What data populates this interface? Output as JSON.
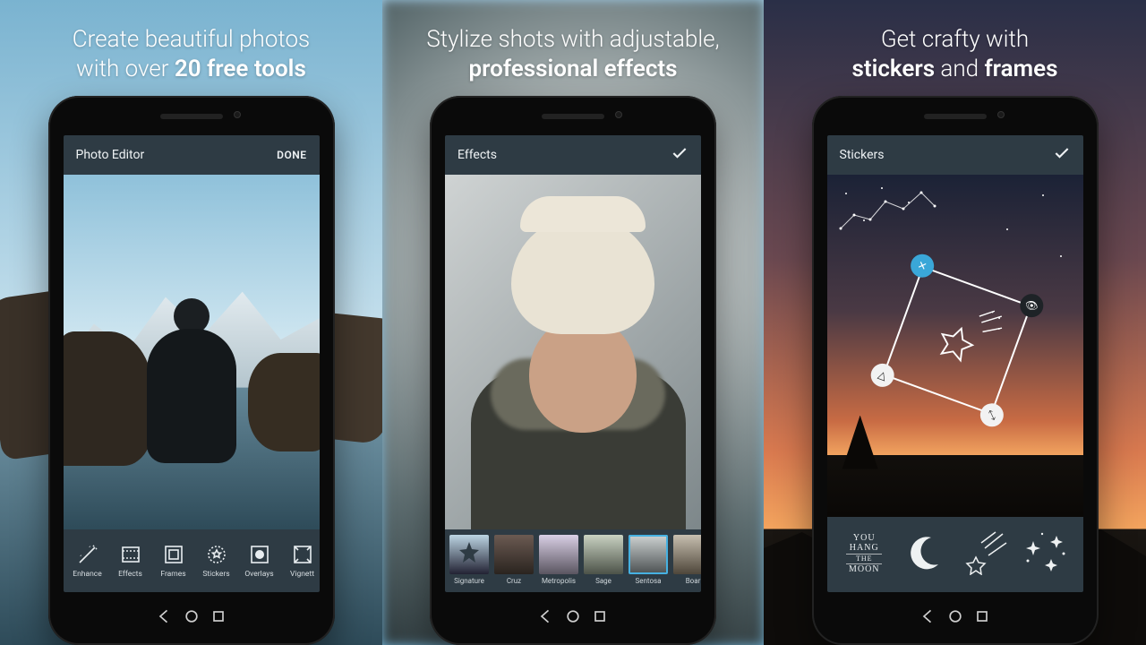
{
  "panels": [
    {
      "headline_pre": "Create beautiful photos",
      "headline_post_pre": "with over ",
      "headline_bold": "20 free tools",
      "appbar_title": "Photo Editor",
      "appbar_action": "DONE",
      "tools": [
        {
          "name": "Enhance"
        },
        {
          "name": "Effects"
        },
        {
          "name": "Frames"
        },
        {
          "name": "Stickers"
        },
        {
          "name": "Overlays"
        },
        {
          "name": "Vignett"
        }
      ]
    },
    {
      "headline_pre": "Stylize shots with adjustable,",
      "headline_bold": "professional effects",
      "appbar_title": "Effects",
      "fx": [
        {
          "name": "Signature",
          "selected": false
        },
        {
          "name": "Cruz",
          "selected": false
        },
        {
          "name": "Metropolis",
          "selected": false
        },
        {
          "name": "Sage",
          "selected": false
        },
        {
          "name": "Sentosa",
          "selected": true
        },
        {
          "name": "Boar",
          "selected": false
        }
      ]
    },
    {
      "headline_pre": "Get crafty with",
      "headline_bold1": "stickers",
      "headline_mid": " and ",
      "headline_bold2": "frames",
      "appbar_title": "Stickers",
      "moon_text": [
        "YOU",
        "HANG",
        "THE",
        "MOON"
      ],
      "sticker_choices": [
        "you-hang-the-moon",
        "crescent-moon",
        "shooting-star",
        "sparkles"
      ]
    }
  ]
}
